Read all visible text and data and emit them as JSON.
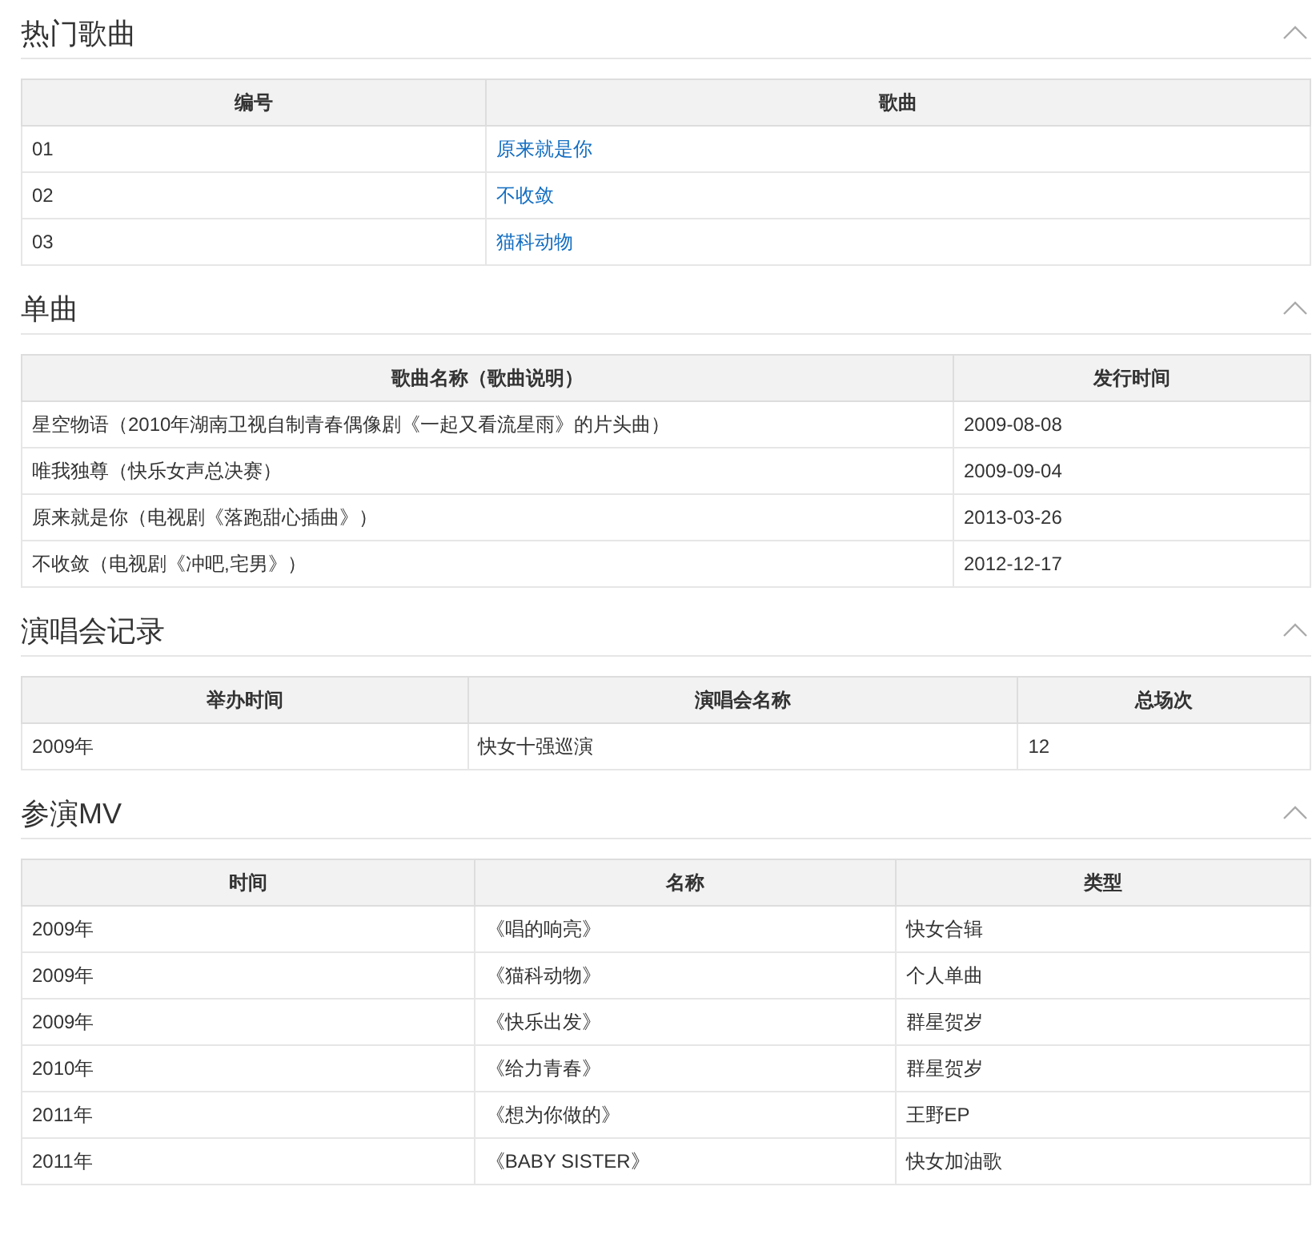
{
  "sections": [
    {
      "title": "热门歌曲",
      "expanded": true,
      "columns": [
        "编号",
        "歌曲"
      ],
      "rows": [
        [
          {
            "kind": "text",
            "text": "01"
          },
          {
            "kind": "link",
            "text": "原来就是你"
          }
        ],
        [
          {
            "kind": "text",
            "text": "02"
          },
          {
            "kind": "link",
            "text": "不收敛"
          }
        ],
        [
          {
            "kind": "text",
            "text": "03"
          },
          {
            "kind": "link",
            "text": "猫科动物"
          }
        ]
      ]
    },
    {
      "title": "单曲",
      "expanded": true,
      "columns": [
        "歌曲名称（歌曲说明）",
        "发行时间"
      ],
      "rows": [
        [
          {
            "kind": "text",
            "text": "星空物语（2010年湖南卫视自制青春偶像剧《一起又看流星雨》的片头曲）"
          },
          {
            "kind": "text",
            "text": "2009-08-08"
          }
        ],
        [
          {
            "kind": "text",
            "text": "唯我独尊（快乐女声总决赛）"
          },
          {
            "kind": "text",
            "text": "2009-09-04"
          }
        ],
        [
          {
            "kind": "text",
            "text": "原来就是你（电视剧《落跑甜心插曲》）"
          },
          {
            "kind": "text",
            "text": "2013-03-26"
          }
        ],
        [
          {
            "kind": "text",
            "text": "不收敛（电视剧《冲吧,宅男》）"
          },
          {
            "kind": "text",
            "text": "2012-12-17"
          }
        ]
      ]
    },
    {
      "title": "演唱会记录",
      "expanded": true,
      "columns": [
        "举办时间",
        "演唱会名称",
        "总场次"
      ],
      "rows": [
        [
          {
            "kind": "text",
            "text": "2009年"
          },
          {
            "kind": "text",
            "text": "快女十强巡演"
          },
          {
            "kind": "text",
            "text": "12"
          }
        ]
      ]
    },
    {
      "title": "参演MV",
      "expanded": true,
      "columns": [
        "时间",
        "名称",
        "类型"
      ],
      "rows": [
        [
          {
            "kind": "text",
            "text": "2009年"
          },
          {
            "kind": "text",
            "text": "《唱的响亮》"
          },
          {
            "kind": "text",
            "text": "快女合辑"
          }
        ],
        [
          {
            "kind": "text",
            "text": "2009年"
          },
          {
            "kind": "text",
            "text": "《猫科动物》"
          },
          {
            "kind": "text",
            "text": "个人单曲"
          }
        ],
        [
          {
            "kind": "text",
            "text": "2009年"
          },
          {
            "kind": "text",
            "text": "《快乐出发》"
          },
          {
            "kind": "text",
            "text": "群星贺岁"
          }
        ],
        [
          {
            "kind": "text",
            "text": "2010年"
          },
          {
            "kind": "text",
            "text": "《给力青春》"
          },
          {
            "kind": "text",
            "text": "群星贺岁"
          }
        ],
        [
          {
            "kind": "text",
            "text": "2011年"
          },
          {
            "kind": "text",
            "text": "《想为你做的》"
          },
          {
            "kind": "text",
            "text": "王野EP"
          }
        ],
        [
          {
            "kind": "text",
            "text": "2011年"
          },
          {
            "kind": "text",
            "text": "《BABY SISTER》"
          },
          {
            "kind": "text",
            "text": "快女加油歌"
          }
        ]
      ]
    }
  ]
}
